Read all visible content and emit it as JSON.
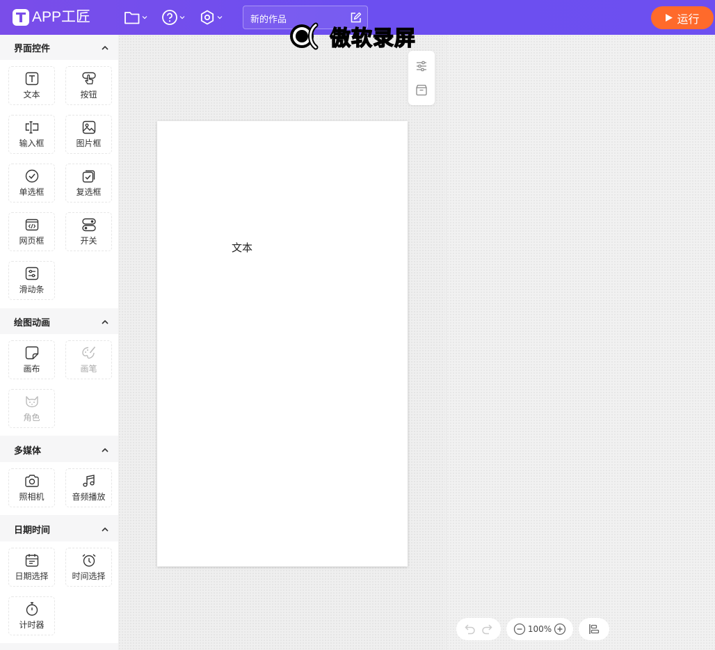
{
  "header": {
    "logo_text": "APP工匠",
    "icons": [
      "folder-icon",
      "help-icon",
      "settings-icon"
    ],
    "project_title": "新的作品",
    "watermark": "傲软录屏",
    "run_label": "运行",
    "colors": {
      "header_bg": "#7a4de9",
      "run_bg": "#ff6a2b"
    }
  },
  "sidebar": {
    "sections": [
      {
        "title": "界面控件",
        "items": [
          "文本",
          "按钮",
          "输入框",
          "图片框",
          "单选框",
          "复选框",
          "网页框",
          "开关",
          "滑动条"
        ]
      },
      {
        "title": "绘图动画",
        "items": [
          "画布",
          "画笔",
          "角色"
        ]
      },
      {
        "title": "多媒体",
        "items": [
          "照相机",
          "音频播放"
        ]
      },
      {
        "title": "日期时间",
        "items": [
          "日期选择",
          "时间选择",
          "计时器"
        ]
      }
    ]
  },
  "canvas": {
    "text_component": "文本"
  },
  "bottom_toolbar": {
    "zoom": "100%"
  }
}
